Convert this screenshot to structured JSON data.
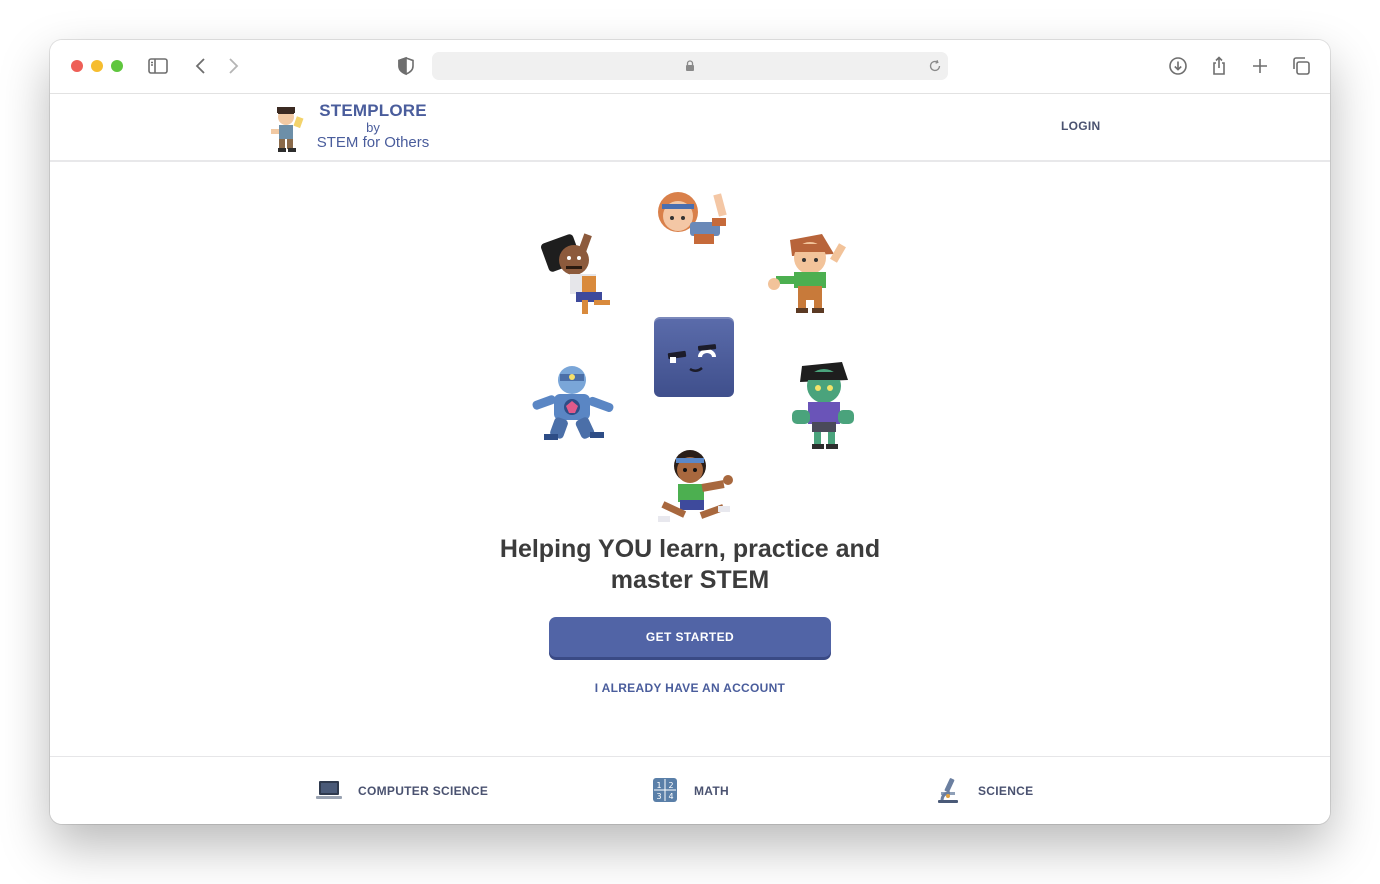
{
  "browser": {
    "toolbar_icons": [
      "sidebar-icon",
      "back-icon",
      "forward-icon",
      "shield-icon",
      "lock-icon",
      "reload-icon",
      "download-icon",
      "share-icon",
      "new-tab-icon",
      "tab-overview-icon"
    ]
  },
  "header": {
    "brand_title": "STEMPLORE",
    "brand_by": "by",
    "brand_sub": "STEM for Others",
    "login_label": "LOGIN"
  },
  "hero": {
    "characters": [
      "girl-headband-character",
      "boy-bun-character",
      "boy-green-shirt-character",
      "robot-character",
      "cube-mascot",
      "zombie-character",
      "girl-green-shirt-character"
    ],
    "headline": "Helping YOU learn, practice and master STEM",
    "cta_label": "GET STARTED",
    "secondary_label": "I ALREADY HAVE AN ACCOUNT"
  },
  "subjects": [
    {
      "label": "COMPUTER SCIENCE",
      "icon": "laptop-icon"
    },
    {
      "label": "MATH",
      "icon": "numbers-icon"
    },
    {
      "label": "SCIENCE",
      "icon": "microscope-icon"
    }
  ],
  "colors": {
    "brand_blue": "#4a5d9c",
    "button_blue": "#5164a6",
    "headline_text": "#3c3c3c"
  }
}
